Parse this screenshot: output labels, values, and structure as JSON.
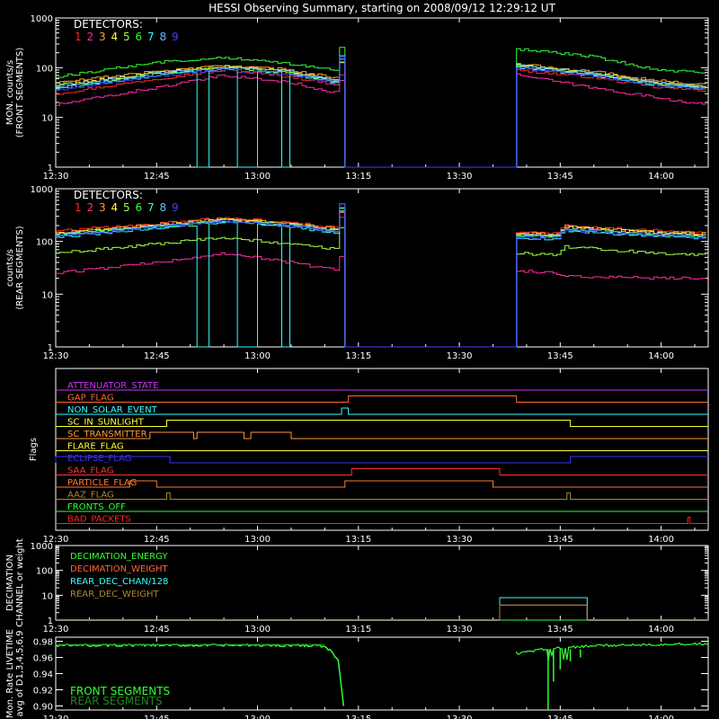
{
  "title": "HESSI Observing Summary, starting on 2008/09/12 12:29:12 UT",
  "colors": {
    "background": "#000000",
    "axes": "#ffffff",
    "detectors": [
      "#ff2a2a",
      "#ff2aa0",
      "#ffa030",
      "#ffff40",
      "#a0ff40",
      "#30ff30",
      "#30ffff",
      "#60c0ff",
      "#4040ff"
    ]
  },
  "time_axis": {
    "start_minutes": 0,
    "end_minutes": 97,
    "ticks": [
      {
        "label": "12:30",
        "minute": 0
      },
      {
        "label": "12:45",
        "minute": 15
      },
      {
        "label": "13:00",
        "minute": 30
      },
      {
        "label": "13:15",
        "minute": 45
      },
      {
        "label": "13:30",
        "minute": 60
      },
      {
        "label": "13:45",
        "minute": 75
      },
      {
        "label": "14:00",
        "minute": 90
      }
    ]
  },
  "chart_data": [
    {
      "type": "line",
      "id": "front",
      "ylabel": [
        "MON. counts/s",
        "(FRONT SEGMENTS)"
      ],
      "legend_title": "DETECTORS:",
      "yscale": "log",
      "ylim": [
        1,
        1000
      ],
      "yticks": [
        "1",
        "10",
        "100",
        "1000"
      ],
      "gap_minutes": [
        43,
        68.5
      ],
      "series": [
        {
          "name": "1",
          "color": "#ff2a2a",
          "pre": [
            [
              0,
              30
            ],
            [
              15,
              60
            ],
            [
              25,
              90
            ],
            [
              35,
              65
            ],
            [
              42,
              45
            ]
          ],
          "post": [
            [
              68.5,
              90
            ],
            [
              80,
              65
            ],
            [
              90,
              40
            ],
            [
              97,
              35
            ]
          ]
        },
        {
          "name": "2",
          "color": "#ff2aa0",
          "pre": [
            [
              0,
              18
            ],
            [
              15,
              40
            ],
            [
              25,
              70
            ],
            [
              35,
              50
            ],
            [
              42,
              30
            ]
          ],
          "post": [
            [
              68.5,
              75
            ],
            [
              80,
              40
            ],
            [
              90,
              25
            ],
            [
              97,
              18
            ]
          ]
        },
        {
          "name": "3",
          "color": "#ffa030",
          "pre": [
            [
              0,
              50
            ],
            [
              15,
              85
            ],
            [
              25,
              110
            ],
            [
              35,
              90
            ],
            [
              42,
              60
            ]
          ],
          "post": [
            [
              68.5,
              120
            ],
            [
              80,
              85
            ],
            [
              90,
              55
            ],
            [
              97,
              45
            ]
          ]
        },
        {
          "name": "4",
          "color": "#ffff40",
          "pre": [
            [
              0,
              45
            ],
            [
              15,
              80
            ],
            [
              25,
              105
            ],
            [
              35,
              85
            ],
            [
              42,
              55
            ]
          ],
          "post": [
            [
              68.5,
              115
            ],
            [
              80,
              80
            ],
            [
              90,
              50
            ],
            [
              97,
              42
            ]
          ]
        },
        {
          "name": "5",
          "color": "#a0ff40",
          "pre": [
            [
              0,
              40
            ],
            [
              15,
              75
            ],
            [
              25,
              100
            ],
            [
              35,
              80
            ],
            [
              42,
              50
            ]
          ],
          "post": [
            [
              68.5,
              110
            ],
            [
              80,
              75
            ],
            [
              90,
              48
            ],
            [
              97,
              40
            ]
          ]
        },
        {
          "name": "6",
          "color": "#30ff30",
          "pre": [
            [
              0,
              65
            ],
            [
              15,
              130
            ],
            [
              25,
              160
            ],
            [
              35,
              120
            ],
            [
              42,
              90
            ]
          ],
          "post": [
            [
              68.5,
              240
            ],
            [
              80,
              170
            ],
            [
              90,
              90
            ],
            [
              97,
              80
            ]
          ]
        },
        {
          "name": "7",
          "color": "#30ffff",
          "pre": [
            [
              0,
              38
            ],
            [
              15,
              70
            ],
            [
              25,
              95
            ],
            [
              35,
              75
            ],
            [
              42,
              48
            ]
          ],
          "post": [
            [
              68.5,
              105
            ],
            [
              80,
              72
            ],
            [
              90,
              45
            ],
            [
              97,
              38
            ]
          ]
        },
        {
          "name": "8",
          "color": "#60c0ff",
          "pre": [
            [
              0,
              42
            ],
            [
              15,
              78
            ],
            [
              25,
              100
            ],
            [
              35,
              82
            ],
            [
              42,
              52
            ]
          ],
          "post": [
            [
              68.5,
              112
            ],
            [
              80,
              78
            ],
            [
              90,
              49
            ],
            [
              97,
              41
            ]
          ]
        },
        {
          "name": "9",
          "color": "#4040ff",
          "pre": [
            [
              0,
              36
            ],
            [
              15,
              68
            ],
            [
              25,
              92
            ],
            [
              35,
              72
            ],
            [
              42,
              46
            ]
          ],
          "post": [
            [
              68.5,
              100
            ],
            [
              80,
              70
            ],
            [
              90,
              44
            ],
            [
              97,
              36
            ]
          ]
        }
      ],
      "dropouts": [
        [
          21,
          22.7
        ],
        [
          26.8,
          30
        ],
        [
          33.3,
          34.4
        ]
      ]
    },
    {
      "type": "line",
      "id": "rear",
      "ylabel": [
        "counts/s",
        "(REAR SEGMENTS)"
      ],
      "legend_title": "DETECTORS:",
      "yscale": "log",
      "ylim": [
        1,
        1000
      ],
      "yticks": [
        "1",
        "10",
        "100",
        "1000"
      ],
      "gap_minutes": [
        43,
        68.5
      ],
      "series": [
        {
          "name": "1",
          "color": "#ff2a2a",
          "pre": [
            [
              0,
              160
            ],
            [
              15,
              220
            ],
            [
              25,
              280
            ],
            [
              35,
              230
            ],
            [
              42,
              180
            ]
          ],
          "post": [
            [
              68.5,
              150
            ],
            [
              75,
              140
            ],
            [
              76,
              200
            ],
            [
              90,
              160
            ],
            [
              97,
              150
            ]
          ]
        },
        {
          "name": "2",
          "color": "#ff2aa0",
          "pre": [
            [
              0,
              25
            ],
            [
              15,
              40
            ],
            [
              25,
              60
            ],
            [
              35,
              40
            ],
            [
              42,
              28
            ]
          ],
          "post": [
            [
              68.5,
              28
            ],
            [
              75,
              25
            ],
            [
              76,
              22
            ],
            [
              90,
              20
            ],
            [
              97,
              20
            ]
          ]
        },
        {
          "name": "3",
          "color": "#ffa030",
          "pre": [
            [
              0,
              150
            ],
            [
              15,
              210
            ],
            [
              25,
              270
            ],
            [
              35,
              220
            ],
            [
              42,
              170
            ]
          ],
          "post": [
            [
              68.5,
              145
            ],
            [
              75,
              135
            ],
            [
              76,
              190
            ],
            [
              90,
              150
            ],
            [
              97,
              140
            ]
          ]
        },
        {
          "name": "4",
          "color": "#ffff40",
          "pre": [
            [
              0,
              140
            ],
            [
              15,
              200
            ],
            [
              25,
              260
            ],
            [
              35,
              210
            ],
            [
              42,
              160
            ]
          ],
          "post": [
            [
              68.5,
              140
            ],
            [
              75,
              130
            ],
            [
              76,
              185
            ],
            [
              90,
              145
            ],
            [
              97,
              135
            ]
          ]
        },
        {
          "name": "5",
          "color": "#a0ff40",
          "pre": [
            [
              0,
              60
            ],
            [
              15,
              90
            ],
            [
              25,
              120
            ],
            [
              35,
              90
            ],
            [
              42,
              70
            ]
          ],
          "post": [
            [
              68.5,
              60
            ],
            [
              75,
              55
            ],
            [
              76,
              80
            ],
            [
              90,
              60
            ],
            [
              97,
              55
            ]
          ]
        },
        {
          "name": "6",
          "color": "#30ff30",
          "pre": [
            [
              0,
              130
            ],
            [
              15,
              190
            ],
            [
              25,
              240
            ],
            [
              35,
              200
            ],
            [
              42,
              150
            ]
          ],
          "post": [
            [
              68.5,
              130
            ],
            [
              75,
              120
            ],
            [
              76,
              170
            ],
            [
              90,
              130
            ],
            [
              97,
              120
            ]
          ]
        },
        {
          "name": "7",
          "color": "#30ffff",
          "pre": [
            [
              0,
              120
            ],
            [
              15,
              180
            ],
            [
              25,
              230
            ],
            [
              35,
              190
            ],
            [
              42,
              140
            ]
          ],
          "post": [
            [
              68.5,
              120
            ],
            [
              75,
              110
            ],
            [
              76,
              160
            ],
            [
              90,
              125
            ],
            [
              97,
              115
            ]
          ]
        },
        {
          "name": "8",
          "color": "#60c0ff",
          "pre": [
            [
              0,
              135
            ],
            [
              15,
              195
            ],
            [
              25,
              250
            ],
            [
              35,
              205
            ],
            [
              42,
              155
            ]
          ],
          "post": [
            [
              68.5,
              135
            ],
            [
              75,
              125
            ],
            [
              76,
              175
            ],
            [
              90,
              140
            ],
            [
              97,
              130
            ]
          ]
        },
        {
          "name": "9",
          "color": "#4040ff",
          "pre": [
            [
              0,
              125
            ],
            [
              15,
              185
            ],
            [
              25,
              245
            ],
            [
              35,
              195
            ],
            [
              42,
              145
            ]
          ],
          "post": [
            [
              68.5,
              125
            ],
            [
              75,
              115
            ],
            [
              76,
              165
            ],
            [
              90,
              130
            ],
            [
              97,
              120
            ]
          ]
        }
      ],
      "dropouts": [
        [
          21,
          22.7
        ],
        [
          26.8,
          30
        ],
        [
          33.3,
          34.4
        ]
      ]
    },
    {
      "type": "flags",
      "id": "flags",
      "ylabel": [
        "Flags"
      ],
      "flags": [
        {
          "name": "ATTENUATOR_STATE",
          "color": "#cc33ff",
          "on": []
        },
        {
          "name": "GAP_FLAG",
          "color": "#ff6633",
          "on": [
            [
              43.5,
              68.5
            ]
          ]
        },
        {
          "name": "NON_SOLAR_EVENT",
          "color": "#33ffff",
          "on": [
            [
              42.5,
              43.5
            ]
          ]
        },
        {
          "name": "SC_IN_SUNLIGHT",
          "color": "#ffff33",
          "on": [
            [
              16.5,
              76.5
            ]
          ]
        },
        {
          "name": "SC_TRANSMITTER",
          "color": "#ff9933",
          "on": [
            [
              14,
              20.5
            ],
            [
              21,
              28
            ],
            [
              29,
              35
            ]
          ]
        },
        {
          "name": "FLARE_FLAG",
          "color": "#ffff33",
          "on": []
        },
        {
          "name": "ECLIPSE_FLAG",
          "color": "#3333ff",
          "on": [
            [
              0,
              17
            ]
          ],
          "onAfter": 76.5
        },
        {
          "name": "SAA_FLAG",
          "color": "#ff3333",
          "on": [
            [
              44,
              66
            ]
          ]
        },
        {
          "name": "PARTICLE_FLAG",
          "color": "#ff7733",
          "on": [
            [
              11,
              15
            ],
            [
              43,
              65
            ]
          ]
        },
        {
          "name": "AAZ_FLAG",
          "color": "#aa8833",
          "on": [
            [
              16.5,
              17
            ],
            [
              76,
              76.5
            ]
          ]
        },
        {
          "name": "FRONTS_OFF",
          "color": "#33ff33",
          "on": []
        },
        {
          "name": "BAD_PACKETS",
          "color": "#ff2222",
          "on": [
            [
              94,
              94.3
            ]
          ]
        }
      ]
    },
    {
      "type": "line",
      "id": "decimation",
      "ylabel": [
        "DECIMATION",
        "CHANNEL or weight"
      ],
      "yscale": "log",
      "ylim": [
        1,
        1000
      ],
      "yticks": [
        "1",
        "10",
        "100",
        "1000"
      ],
      "series": [
        {
          "name": "DECIMATION_ENERGY",
          "color": "#33ff33",
          "base": 1,
          "high": 1,
          "window": [
            66,
            79
          ]
        },
        {
          "name": "DECIMATION_WEIGHT",
          "color": "#ff6633",
          "base": 1,
          "high": 4,
          "window": [
            66,
            79
          ]
        },
        {
          "name": "REAR_DEC_CHAN/128",
          "color": "#33ffff",
          "base": 1,
          "high": 8,
          "window": [
            66,
            79
          ]
        },
        {
          "name": "REAR_DEC_WEIGHT",
          "color": "#aa8833",
          "base": 1,
          "high": 4,
          "window": [
            66,
            79
          ]
        }
      ]
    },
    {
      "type": "line",
      "id": "livetime",
      "ylabel": [
        "Mon. Rate LIVETIME",
        "avg of D1,3,4,5,6,9"
      ],
      "yscale": "linear",
      "ylim": [
        0.895,
        0.985
      ],
      "yticks": [
        "0.90",
        "0.92",
        "0.94",
        "0.96",
        "0.98"
      ],
      "ytick_values": [
        0.9,
        0.92,
        0.94,
        0.96,
        0.98
      ],
      "series": [
        {
          "name": "FRONT SEGMENTS",
          "color": "#33ff33"
        },
        {
          "name": "REAR SEGMENTS",
          "color": "#1f8a1f"
        }
      ]
    }
  ]
}
